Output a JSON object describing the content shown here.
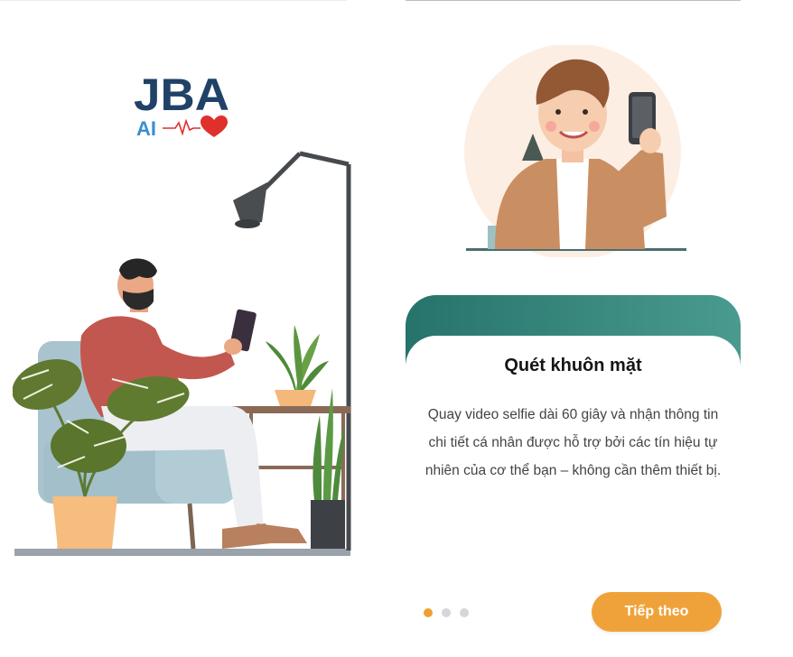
{
  "logo": {
    "main": "JBA",
    "sub": "AI",
    "icon": "heart-pulse-icon"
  },
  "slide": {
    "title": "Quét khuôn mặt",
    "description": "Quay video selfie dài 60 giây và nhận thông tin chi tiết cá nhân được hỗ trợ bởi các tín hiệu tự nhiên của cơ thể bạn – không cần thêm thiết bị."
  },
  "pagination": {
    "total": 3,
    "active_index": 0
  },
  "buttons": {
    "next": "Tiếp theo"
  },
  "colors": {
    "accent": "#f0a23a",
    "teal": "#3a8c82",
    "logo_blue": "#1f4266",
    "heart": "#e0302c"
  }
}
